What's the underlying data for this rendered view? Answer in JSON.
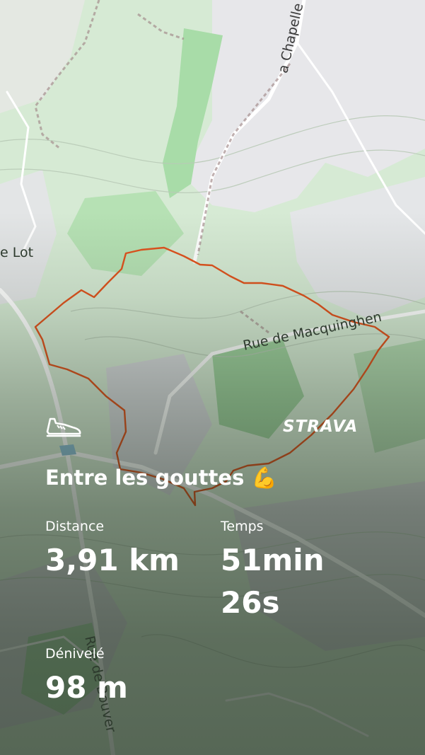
{
  "map": {
    "streets": [
      {
        "id": "la-chapelle",
        "text": "a Chapelle"
      },
      {
        "id": "le-lot",
        "text": "e Lot"
      },
      {
        "id": "macquinghen",
        "text": "Rue de Macquinghen"
      },
      {
        "id": "bouvet",
        "text": "Rue de Bouver"
      }
    ],
    "route_color": "#e0531e"
  },
  "activity": {
    "type_icon": "running-shoe-icon",
    "brand": "STRAVA",
    "title": "Entre les gouttes",
    "title_emoji": "💪",
    "stats": {
      "distance": {
        "label": "Distance",
        "value": "3,91 km"
      },
      "time": {
        "label": "Temps",
        "value_line1": "51min",
        "value_line2": "26s"
      },
      "elevation": {
        "label": "Dénivelé",
        "value": "98 m"
      }
    }
  }
}
